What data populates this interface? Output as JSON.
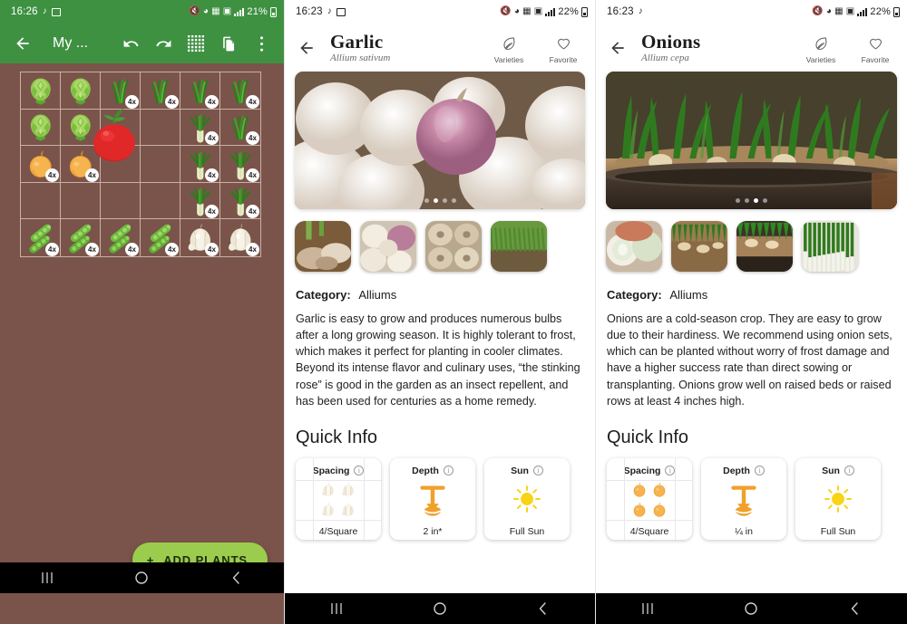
{
  "panel1": {
    "status": {
      "time": "16:26",
      "battery": "21%",
      "icons": [
        "music-note-icon",
        "photo-icon",
        "mute-icon",
        "cast-icon",
        "vpn-icon",
        "sd-icon",
        "signal-icon",
        "battery-icon"
      ]
    },
    "appbar": {
      "back": "back-arrow",
      "title": "My ...",
      "actions": [
        "undo",
        "redo",
        "grid",
        "copy",
        "overflow-menu"
      ]
    },
    "fab": {
      "label": "ADD PLANTS",
      "plus": "+"
    },
    "nav": {
      "recents": "|||",
      "home": "○",
      "back": "‹"
    },
    "grid": {
      "cols": 6,
      "rows": 5,
      "cells": [
        {
          "plant": "artichoke",
          "qty": null
        },
        {
          "plant": "artichoke",
          "qty": null
        },
        {
          "plant": "chives",
          "qty": "4x"
        },
        {
          "plant": "chives",
          "qty": "4x"
        },
        {
          "plant": "chives",
          "qty": "4x"
        },
        {
          "plant": "chives",
          "qty": "4x"
        },
        {
          "plant": "artichoke",
          "qty": null
        },
        {
          "plant": "artichoke",
          "qty": null
        },
        {
          "plant": null,
          "qty": null
        },
        {
          "plant": null,
          "qty": null
        },
        {
          "plant": "leek",
          "qty": "4x"
        },
        {
          "plant": "chives",
          "qty": "4x"
        },
        {
          "plant": "onion",
          "qty": "4x"
        },
        {
          "plant": "onion",
          "qty": "4x"
        },
        {
          "plant": null,
          "qty": null
        },
        {
          "plant": null,
          "qty": null
        },
        {
          "plant": "leek",
          "qty": "4x"
        },
        {
          "plant": "leek",
          "qty": "4x"
        },
        {
          "plant": null,
          "qty": null
        },
        {
          "plant": null,
          "qty": null
        },
        {
          "plant": null,
          "qty": null
        },
        {
          "plant": null,
          "qty": null
        },
        {
          "plant": "leek",
          "qty": "4x"
        },
        {
          "plant": "leek",
          "qty": "4x"
        },
        {
          "plant": "peas",
          "qty": "4x"
        },
        {
          "plant": "peas",
          "qty": "4x"
        },
        {
          "plant": "peas",
          "qty": "4x"
        },
        {
          "plant": "peas",
          "qty": "4x"
        },
        {
          "plant": "garlic",
          "qty": "4x"
        },
        {
          "plant": "garlic",
          "qty": "4x"
        }
      ],
      "overlay_plant": "tomato"
    },
    "colors": {
      "appbar": "#3f9142",
      "soil": "#7a544a",
      "gridline": "#c9b0a5",
      "fab": "#9ccc4d"
    }
  },
  "panel2": {
    "status": {
      "time": "16:23",
      "battery": "22%"
    },
    "header": {
      "back": "back-arrow",
      "title": "Garlic",
      "subtitle": "Allium sativum",
      "actions": [
        {
          "label": "Varieties",
          "icon": "leaf-icon"
        },
        {
          "label": "Favorite",
          "icon": "heart-icon"
        }
      ]
    },
    "carousel": {
      "count": 4,
      "active": 1
    },
    "thumbnails": [
      "garlic-harvest",
      "garlic-bulbs-purple",
      "garlic-bulbs-dry",
      "garlic-field"
    ],
    "category_label": "Category:",
    "category_value": "Alliums",
    "description": "Garlic is easy to grow and produces numerous bulbs after a long growing season. It is highly tolerant to frost, which makes it perfect for planting in cooler climates. Beyond its intense flavor and culinary uses, “the stinking rose” is good in the garden as an insect repellent, and has been used for centuries as a home remedy.",
    "quick_info_title": "Quick Info",
    "quick_info": [
      {
        "label": "Spacing",
        "value": "4/Square",
        "icon": "garlic-bulb-icon",
        "info": "i"
      },
      {
        "label": "Depth",
        "value": "2 in*",
        "icon": "depth-arrow-icon",
        "info": "i"
      },
      {
        "label": "Sun",
        "value": "Full Sun",
        "icon": "sun-icon",
        "info": "i"
      }
    ],
    "nav": {
      "recents": "|||",
      "home": "○",
      "back": "‹"
    }
  },
  "panel3": {
    "status": {
      "time": "16:23",
      "battery": "22%"
    },
    "header": {
      "back": "back-arrow",
      "title": "Onions",
      "subtitle": "Allium cepa",
      "actions": [
        {
          "label": "Varieties",
          "icon": "leaf-icon"
        },
        {
          "label": "Favorite",
          "icon": "heart-icon"
        }
      ]
    },
    "carousel": {
      "count": 4,
      "active": 2
    },
    "thumbnails": [
      "onion-cut",
      "onion-sets-soil",
      "onion-sprouts-pot",
      "scallions-bunch"
    ],
    "category_label": "Category:",
    "category_value": "Alliums",
    "description": "Onions are a cold-season crop. They are easy to grow due to their hardiness. We recommend using onion sets, which can be planted without worry of frost damage and have a higher success rate than direct sowing or transplanting. Onions grow well on raised beds or raised rows at least 4 inches high.",
    "quick_info_title": "Quick Info",
    "quick_info": [
      {
        "label": "Spacing",
        "value": "4/Square",
        "icon": "onion-bulb-icon",
        "info": "i"
      },
      {
        "label": "Depth",
        "value": "¼ in",
        "icon": "depth-arrow-icon",
        "info": "i"
      },
      {
        "label": "Sun",
        "value": "Full Sun",
        "icon": "sun-icon",
        "info": "i"
      }
    ],
    "nav": {
      "recents": "|||",
      "home": "○",
      "back": "‹"
    }
  }
}
